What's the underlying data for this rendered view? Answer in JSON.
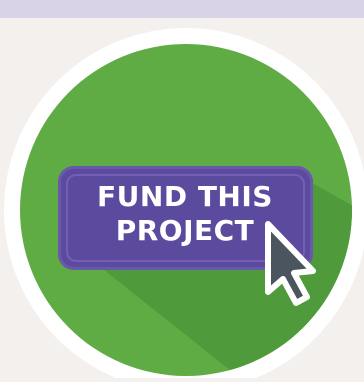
{
  "badge": {
    "button": {
      "line1": "FUND THIS",
      "line2": "PROJECT"
    },
    "icon": "mouse-cursor-icon"
  },
  "colors": {
    "background": "#f3f0ee",
    "top_band": "#d9d3e8",
    "circle_ring": "#ffffff",
    "circle_fill": "#5fac45",
    "long_shadow": "#4f9a3b",
    "button_fill": "#5b4a9e",
    "button_border": "#7360b6",
    "cursor_fill": "#4a5560",
    "cursor_outline": "#ffffff"
  }
}
